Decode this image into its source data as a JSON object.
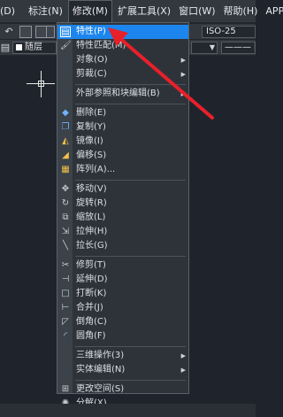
{
  "menubar": {
    "items": [
      {
        "label": "(D)"
      },
      {
        "label": "标注(N)"
      },
      {
        "label": "修改(M)"
      },
      {
        "label": "扩展工具(X)"
      },
      {
        "label": "窗口(W)"
      },
      {
        "label": "帮助(H)"
      },
      {
        "label": "APP+"
      }
    ]
  },
  "toolbar": {
    "dimstyle_value": "ISO-25",
    "layer_value": "随层",
    "lineweight_value": "——— 随"
  },
  "menu": {
    "items": [
      {
        "label": "特性(P)",
        "icon": "properties-icon",
        "glyph": "▤",
        "submenu": false,
        "highlighted": true
      },
      {
        "label": "特性匹配(M)",
        "icon": "match-properties-brush-icon",
        "glyph": "🖌",
        "submenu": false
      },
      {
        "label": "对象(O)",
        "icon": "",
        "glyph": "",
        "submenu": true
      },
      {
        "label": "剪裁(C)",
        "icon": "",
        "glyph": "",
        "submenu": true
      },
      {
        "separator": true
      },
      {
        "label": "外部参照和块编辑(B)",
        "icon": "",
        "glyph": "",
        "submenu": true
      },
      {
        "separator": true
      },
      {
        "label": "删除(E)",
        "icon": "eraser-icon",
        "glyph": "◆",
        "submenu": false
      },
      {
        "label": "复制(Y)",
        "icon": "copy-icon",
        "glyph": "❐",
        "submenu": false
      },
      {
        "label": "镜像(I)",
        "icon": "mirror-icon",
        "glyph": "◭",
        "submenu": false
      },
      {
        "label": "偏移(S)",
        "icon": "offset-icon",
        "glyph": "◢",
        "submenu": false
      },
      {
        "label": "阵列(A)...",
        "icon": "array-icon",
        "glyph": "▦",
        "submenu": false
      },
      {
        "separator": true
      },
      {
        "label": "移动(V)",
        "icon": "move-icon",
        "glyph": "✥",
        "submenu": false
      },
      {
        "label": "旋转(R)",
        "icon": "rotate-icon",
        "glyph": "↻",
        "submenu": false
      },
      {
        "label": "缩放(L)",
        "icon": "scale-icon",
        "glyph": "⧉",
        "submenu": false
      },
      {
        "label": "拉伸(H)",
        "icon": "stretch-icon",
        "glyph": "⇲",
        "submenu": false
      },
      {
        "label": "拉长(G)",
        "icon": "lengthen-icon",
        "glyph": "╲",
        "submenu": false
      },
      {
        "separator": true
      },
      {
        "label": "修剪(T)",
        "icon": "trim-icon",
        "glyph": "✂",
        "submenu": false
      },
      {
        "label": "延伸(D)",
        "icon": "extend-icon",
        "glyph": "⊣",
        "submenu": false
      },
      {
        "label": "打断(K)",
        "icon": "break-icon",
        "glyph": "□",
        "submenu": false
      },
      {
        "label": "合并(J)",
        "icon": "join-icon",
        "glyph": "⊢",
        "submenu": false
      },
      {
        "label": "倒角(C)",
        "icon": "chamfer-icon",
        "glyph": "◸",
        "submenu": false
      },
      {
        "label": "圆角(F)",
        "icon": "fillet-icon",
        "glyph": "◜",
        "submenu": false
      },
      {
        "separator": true
      },
      {
        "label": "三维操作(3)",
        "icon": "",
        "glyph": "",
        "submenu": true
      },
      {
        "label": "实体编辑(N)",
        "icon": "",
        "glyph": "",
        "submenu": true
      },
      {
        "separator": true
      },
      {
        "label": "更改空间(S)",
        "icon": "change-space-icon",
        "glyph": "⊞",
        "submenu": false
      },
      {
        "label": "分解(X)",
        "icon": "explode-icon",
        "glyph": "✺",
        "submenu": false
      }
    ]
  },
  "colors": {
    "highlight": "#1c86ee",
    "arrow": "#e8202a",
    "background": "#1f242c"
  }
}
